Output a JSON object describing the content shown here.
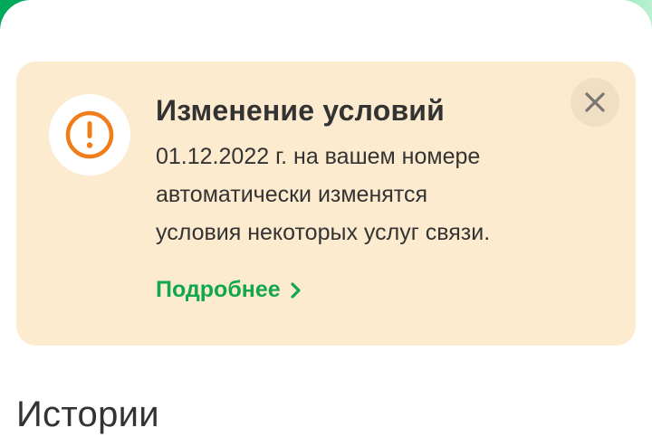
{
  "colors": {
    "brand_green": "#00b15a",
    "banner_bg": "#fdebcf",
    "warning_orange": "#f07d1a",
    "link_green": "#12a64e",
    "text_dark": "#333333"
  },
  "banner": {
    "icon": "exclamation-circle-icon",
    "title": "Изменение условий",
    "text_lines": [
      "01.12.2022 г. на вашем номере",
      "автоматически изменятся",
      "условия некоторых услуг связи."
    ],
    "link_label": "Подробнее",
    "link_icon": "chevron-right-icon",
    "close_icon": "close-icon"
  },
  "stories": {
    "title": "Истории"
  }
}
